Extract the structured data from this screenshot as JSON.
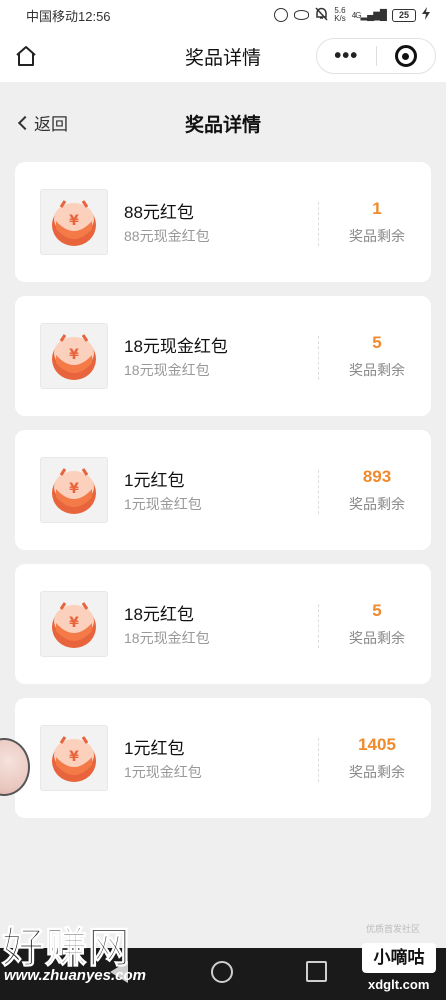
{
  "status_bar": {
    "carrier_time": "中国移动12:56",
    "speed_top": "5.6",
    "speed_bottom": "K/s",
    "network": "4G",
    "battery": "25"
  },
  "titlebar": {
    "title": "奖品详情",
    "more_label": "•••"
  },
  "header": {
    "back_label": "返回",
    "title": "奖品详情"
  },
  "prizes": [
    {
      "name": "88元红包",
      "desc": "88元现金红包",
      "count": "1",
      "count_label": "奖品剩余"
    },
    {
      "name": "18元现金红包",
      "desc": "18元现金红包",
      "count": "5",
      "count_label": "奖品剩余"
    },
    {
      "name": "1元红包",
      "desc": "1元现金红包",
      "count": "893",
      "count_label": "奖品剩余"
    },
    {
      "name": "18元红包",
      "desc": "18元现金红包",
      "count": "5",
      "count_label": "奖品剩余"
    },
    {
      "name": "1元红包",
      "desc": "1元现金红包",
      "count": "1405",
      "count_label": "奖品剩余"
    }
  ],
  "watermarks": {
    "left_big": "好赚网",
    "left_site": "www.zhuanyes.com",
    "right_small": "优质首发社区",
    "right_logo": "小嘀咕",
    "right_site": "xdglt.com"
  },
  "colors": {
    "accent": "#f08a2c",
    "background": "#efefef"
  }
}
